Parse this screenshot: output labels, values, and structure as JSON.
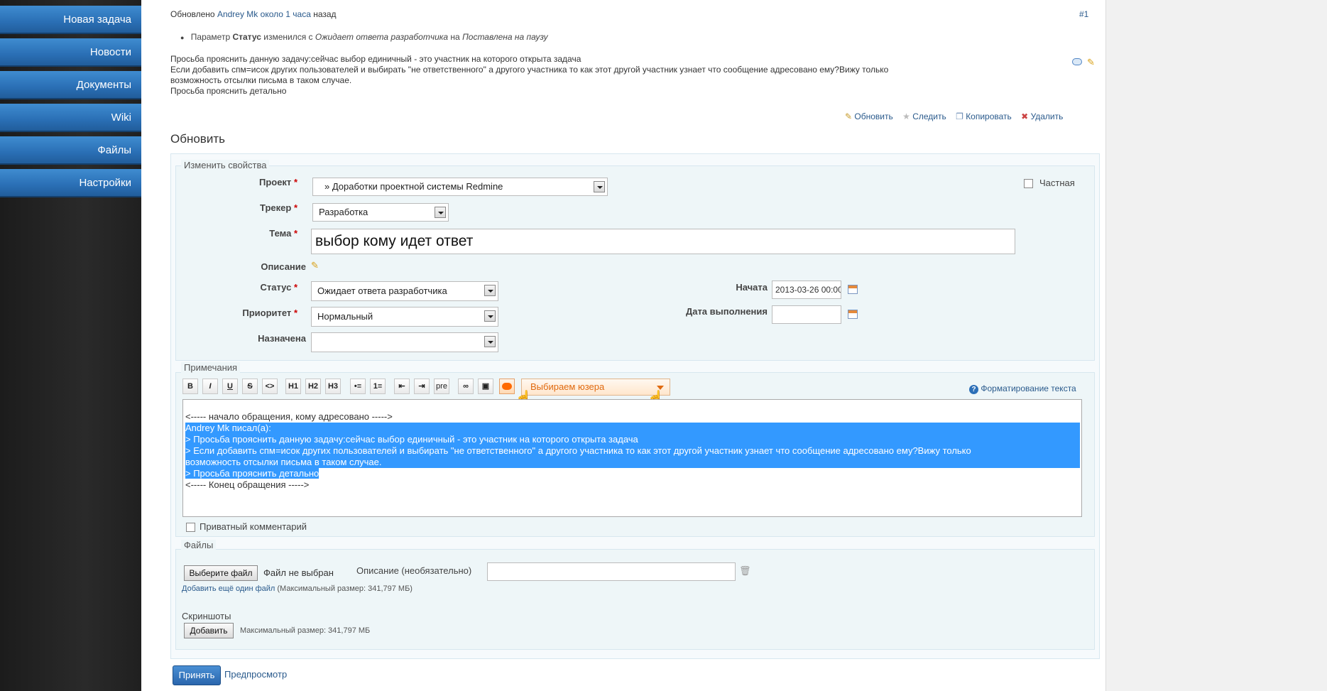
{
  "sidebar": {
    "items": [
      "Новая задача",
      "Новости",
      "Документы",
      "Wiki",
      "Файлы",
      "Настройки"
    ]
  },
  "journal": {
    "updated_prefix": "Обновлено",
    "author": "Andrey Mk",
    "time_ago": "около 1 часа",
    "suffix": "назад",
    "number": "#1",
    "detail_prefix": "Параметр",
    "detail_field": "Статус",
    "detail_mid": "изменился с",
    "detail_old": "Ожидает ответа разработчика",
    "detail_on": "на",
    "detail_new": "Поставлена на паузу",
    "notes": [
      "Просьба прояснить данную задачу:сейчас выбор единичный - это участник на которого открыта задача",
      "Если добавить спм=исок других пользователей и выбирать \"не ответственного\" а другого участника то как этот другой участник узнает что сообщение адресовано ему?Вижу только",
      "возможность отсылки письма в таком случае.",
      "Просьба прояснить детально"
    ]
  },
  "actions": {
    "update": "Обновить",
    "watch": "Следить",
    "copy": "Копировать",
    "delete": "Удалить"
  },
  "form": {
    "title": "Обновить",
    "props_legend": "Изменить свойства",
    "project_label": "Проект",
    "project_value": "» Доработки проектной системы Redmine",
    "private_label": "Частная",
    "tracker_label": "Трекер",
    "tracker_value": "Разработка",
    "subject_label": "Тема",
    "subject_value": "выбор кому идет ответ",
    "description_label": "Описание",
    "status_label": "Статус",
    "status_value": "Ожидает ответа разработчика",
    "priority_label": "Приоритет",
    "priority_value": "Нормальный",
    "assignee_label": "Назначена",
    "assignee_value": "",
    "start_label": "Начата",
    "start_value": "2013-03-26 00:00",
    "due_label": "Дата выполнения",
    "due_value": ""
  },
  "notes_section": {
    "legend": "Примечания",
    "toolbar": [
      "B",
      "I",
      "U",
      "S",
      "<>",
      "H1",
      "H2",
      "H3",
      "•≡",
      "1≡",
      "⇤",
      "⇥",
      "pre",
      "∞",
      "▣"
    ],
    "user_select": "Выбираем юзера",
    "formatting_link": "Форматирование текста",
    "text_lines": [
      "<----- начало обращения, кому адресовано ----->",
      "Andrey Mk писал(а):",
      "> Просьба прояснить данную задачу:сейчас выбор единичный - это участник на которого открыта задача",
      "> Если добавить спм=исок других пользователей и выбирать \"не ответственного\" а другого участника то как этот другой участник узнает что сообщение адресовано ему?Вижу только",
      "возможность отсылки письма в таком случае.",
      "> Просьба прояснить детально",
      "<----- Конец обращения ----->"
    ],
    "private_comment": "Приватный комментарий"
  },
  "files": {
    "legend": "Файлы",
    "choose_button": "Выберите файл",
    "no_file": "Файл не выбран",
    "description_placeholder": "Описание (необязательно)",
    "add_link": "Добавить ещё один файл",
    "max_size": "(Максимальный размер: 341,797 МБ)",
    "screenshots_label": "Скриншоты",
    "add_button": "Добавить",
    "screenshots_max": "Максимальный размер: 341,797 МБ"
  },
  "submit": {
    "accept": "Принять",
    "preview": "Предпросмотр"
  }
}
